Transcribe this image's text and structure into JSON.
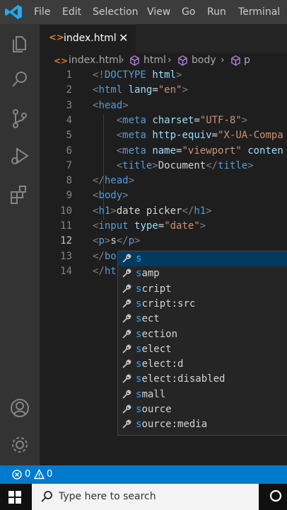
{
  "menu": [
    "File",
    "Edit",
    "Selection",
    "View",
    "Go",
    "Run",
    "Terminal"
  ],
  "activity_icons": [
    "explorer-icon",
    "search-icon",
    "source-control-icon",
    "run-debug-icon",
    "extensions-icon",
    "account-icon",
    "settings-gear-icon"
  ],
  "tab": {
    "icon": "<>",
    "name": "index.html",
    "close": "✕"
  },
  "breadcrumbs": {
    "file": "index.html",
    "sep": "›",
    "items": [
      "html",
      "body",
      "p"
    ]
  },
  "code": {
    "line_numbers": [
      "1",
      "2",
      "3",
      "4",
      "5",
      "6",
      "7",
      "8",
      "9",
      "10",
      "11",
      "12",
      "13",
      "14"
    ],
    "lines": [
      [
        {
          "c": "b",
          "t": "<!"
        },
        {
          "c": "t",
          "t": "DOCTYPE"
        },
        {
          "c": "x",
          "t": " "
        },
        {
          "c": "a",
          "t": "html"
        },
        {
          "c": "b",
          "t": ">"
        }
      ],
      [
        {
          "c": "b",
          "t": "<"
        },
        {
          "c": "t",
          "t": "html"
        },
        {
          "c": "x",
          "t": " "
        },
        {
          "c": "a",
          "t": "lang"
        },
        {
          "c": "x",
          "t": "="
        },
        {
          "c": "s",
          "t": "\"en\""
        },
        {
          "c": "b",
          "t": ">"
        }
      ],
      [
        {
          "c": "b",
          "t": "<"
        },
        {
          "c": "t",
          "t": "head"
        },
        {
          "c": "b",
          "t": ">"
        }
      ],
      [
        {
          "c": "x",
          "t": "    "
        },
        {
          "c": "b",
          "t": "<"
        },
        {
          "c": "t",
          "t": "meta"
        },
        {
          "c": "x",
          "t": " "
        },
        {
          "c": "a",
          "t": "charset"
        },
        {
          "c": "x",
          "t": "="
        },
        {
          "c": "s",
          "t": "\"UTF-8\""
        },
        {
          "c": "b",
          "t": ">"
        }
      ],
      [
        {
          "c": "x",
          "t": "    "
        },
        {
          "c": "b",
          "t": "<"
        },
        {
          "c": "t",
          "t": "meta"
        },
        {
          "c": "x",
          "t": " "
        },
        {
          "c": "a",
          "t": "http-equiv"
        },
        {
          "c": "x",
          "t": "="
        },
        {
          "c": "s",
          "t": "\"X-UA-Compa"
        }
      ],
      [
        {
          "c": "x",
          "t": "    "
        },
        {
          "c": "b",
          "t": "<"
        },
        {
          "c": "t",
          "t": "meta"
        },
        {
          "c": "x",
          "t": " "
        },
        {
          "c": "a",
          "t": "name"
        },
        {
          "c": "x",
          "t": "="
        },
        {
          "c": "s",
          "t": "\"viewport\""
        },
        {
          "c": "x",
          "t": " "
        },
        {
          "c": "a",
          "t": "conten"
        }
      ],
      [
        {
          "c": "x",
          "t": "    "
        },
        {
          "c": "b",
          "t": "<"
        },
        {
          "c": "t",
          "t": "title"
        },
        {
          "c": "b",
          "t": ">"
        },
        {
          "c": "x",
          "t": "Document"
        },
        {
          "c": "b",
          "t": "</"
        },
        {
          "c": "t",
          "t": "title"
        },
        {
          "c": "b",
          "t": ">"
        }
      ],
      [
        {
          "c": "b",
          "t": "</"
        },
        {
          "c": "t",
          "t": "head"
        },
        {
          "c": "b",
          "t": ">"
        }
      ],
      [
        {
          "c": "b",
          "t": "<"
        },
        {
          "c": "t",
          "t": "body"
        },
        {
          "c": "b",
          "t": ">"
        }
      ],
      [
        {
          "c": "b",
          "t": "<"
        },
        {
          "c": "t",
          "t": "h1"
        },
        {
          "c": "b",
          "t": ">"
        },
        {
          "c": "x",
          "t": "date picker"
        },
        {
          "c": "b",
          "t": "</"
        },
        {
          "c": "t",
          "t": "h1"
        },
        {
          "c": "b",
          "t": ">"
        }
      ],
      [
        {
          "c": "b",
          "t": "<"
        },
        {
          "c": "t",
          "t": "input"
        },
        {
          "c": "x",
          "t": " "
        },
        {
          "c": "a",
          "t": "type"
        },
        {
          "c": "x",
          "t": "="
        },
        {
          "c": "s",
          "t": "\"date\""
        },
        {
          "c": "b",
          "t": ">"
        }
      ],
      [
        {
          "c": "b",
          "t": "<"
        },
        {
          "c": "t",
          "t": "p"
        },
        {
          "c": "b",
          "t": ">"
        },
        {
          "c": "x",
          "t": "s"
        },
        {
          "c": "b",
          "t": "</"
        },
        {
          "c": "t",
          "t": "p"
        },
        {
          "c": "b",
          "t": ">"
        }
      ],
      [
        {
          "c": "b",
          "t": "</"
        },
        {
          "c": "t",
          "t": "bo"
        }
      ],
      [
        {
          "c": "b",
          "t": "</"
        },
        {
          "c": "t",
          "t": "ht"
        }
      ]
    ]
  },
  "suggestions": [
    {
      "match": "s",
      "rest": ""
    },
    {
      "match": "s",
      "rest": "amp"
    },
    {
      "match": "s",
      "rest": "cript"
    },
    {
      "match": "s",
      "rest": "cript:src"
    },
    {
      "match": "s",
      "rest": "ect"
    },
    {
      "match": "s",
      "rest": "ection"
    },
    {
      "match": "s",
      "rest": "elect"
    },
    {
      "match": "s",
      "rest": "elect:d"
    },
    {
      "match": "s",
      "rest": "elect:disabled"
    },
    {
      "match": "s",
      "rest": "mall"
    },
    {
      "match": "s",
      "rest": "ource"
    },
    {
      "match": "s",
      "rest": "ource:media"
    }
  ],
  "status": {
    "errors": "0",
    "warnings": "0"
  },
  "taskbar": {
    "search_placeholder": "Type here to search"
  },
  "colors": {
    "accent": "#007acc",
    "selected": "#04395e",
    "match": "#2aaaff"
  }
}
